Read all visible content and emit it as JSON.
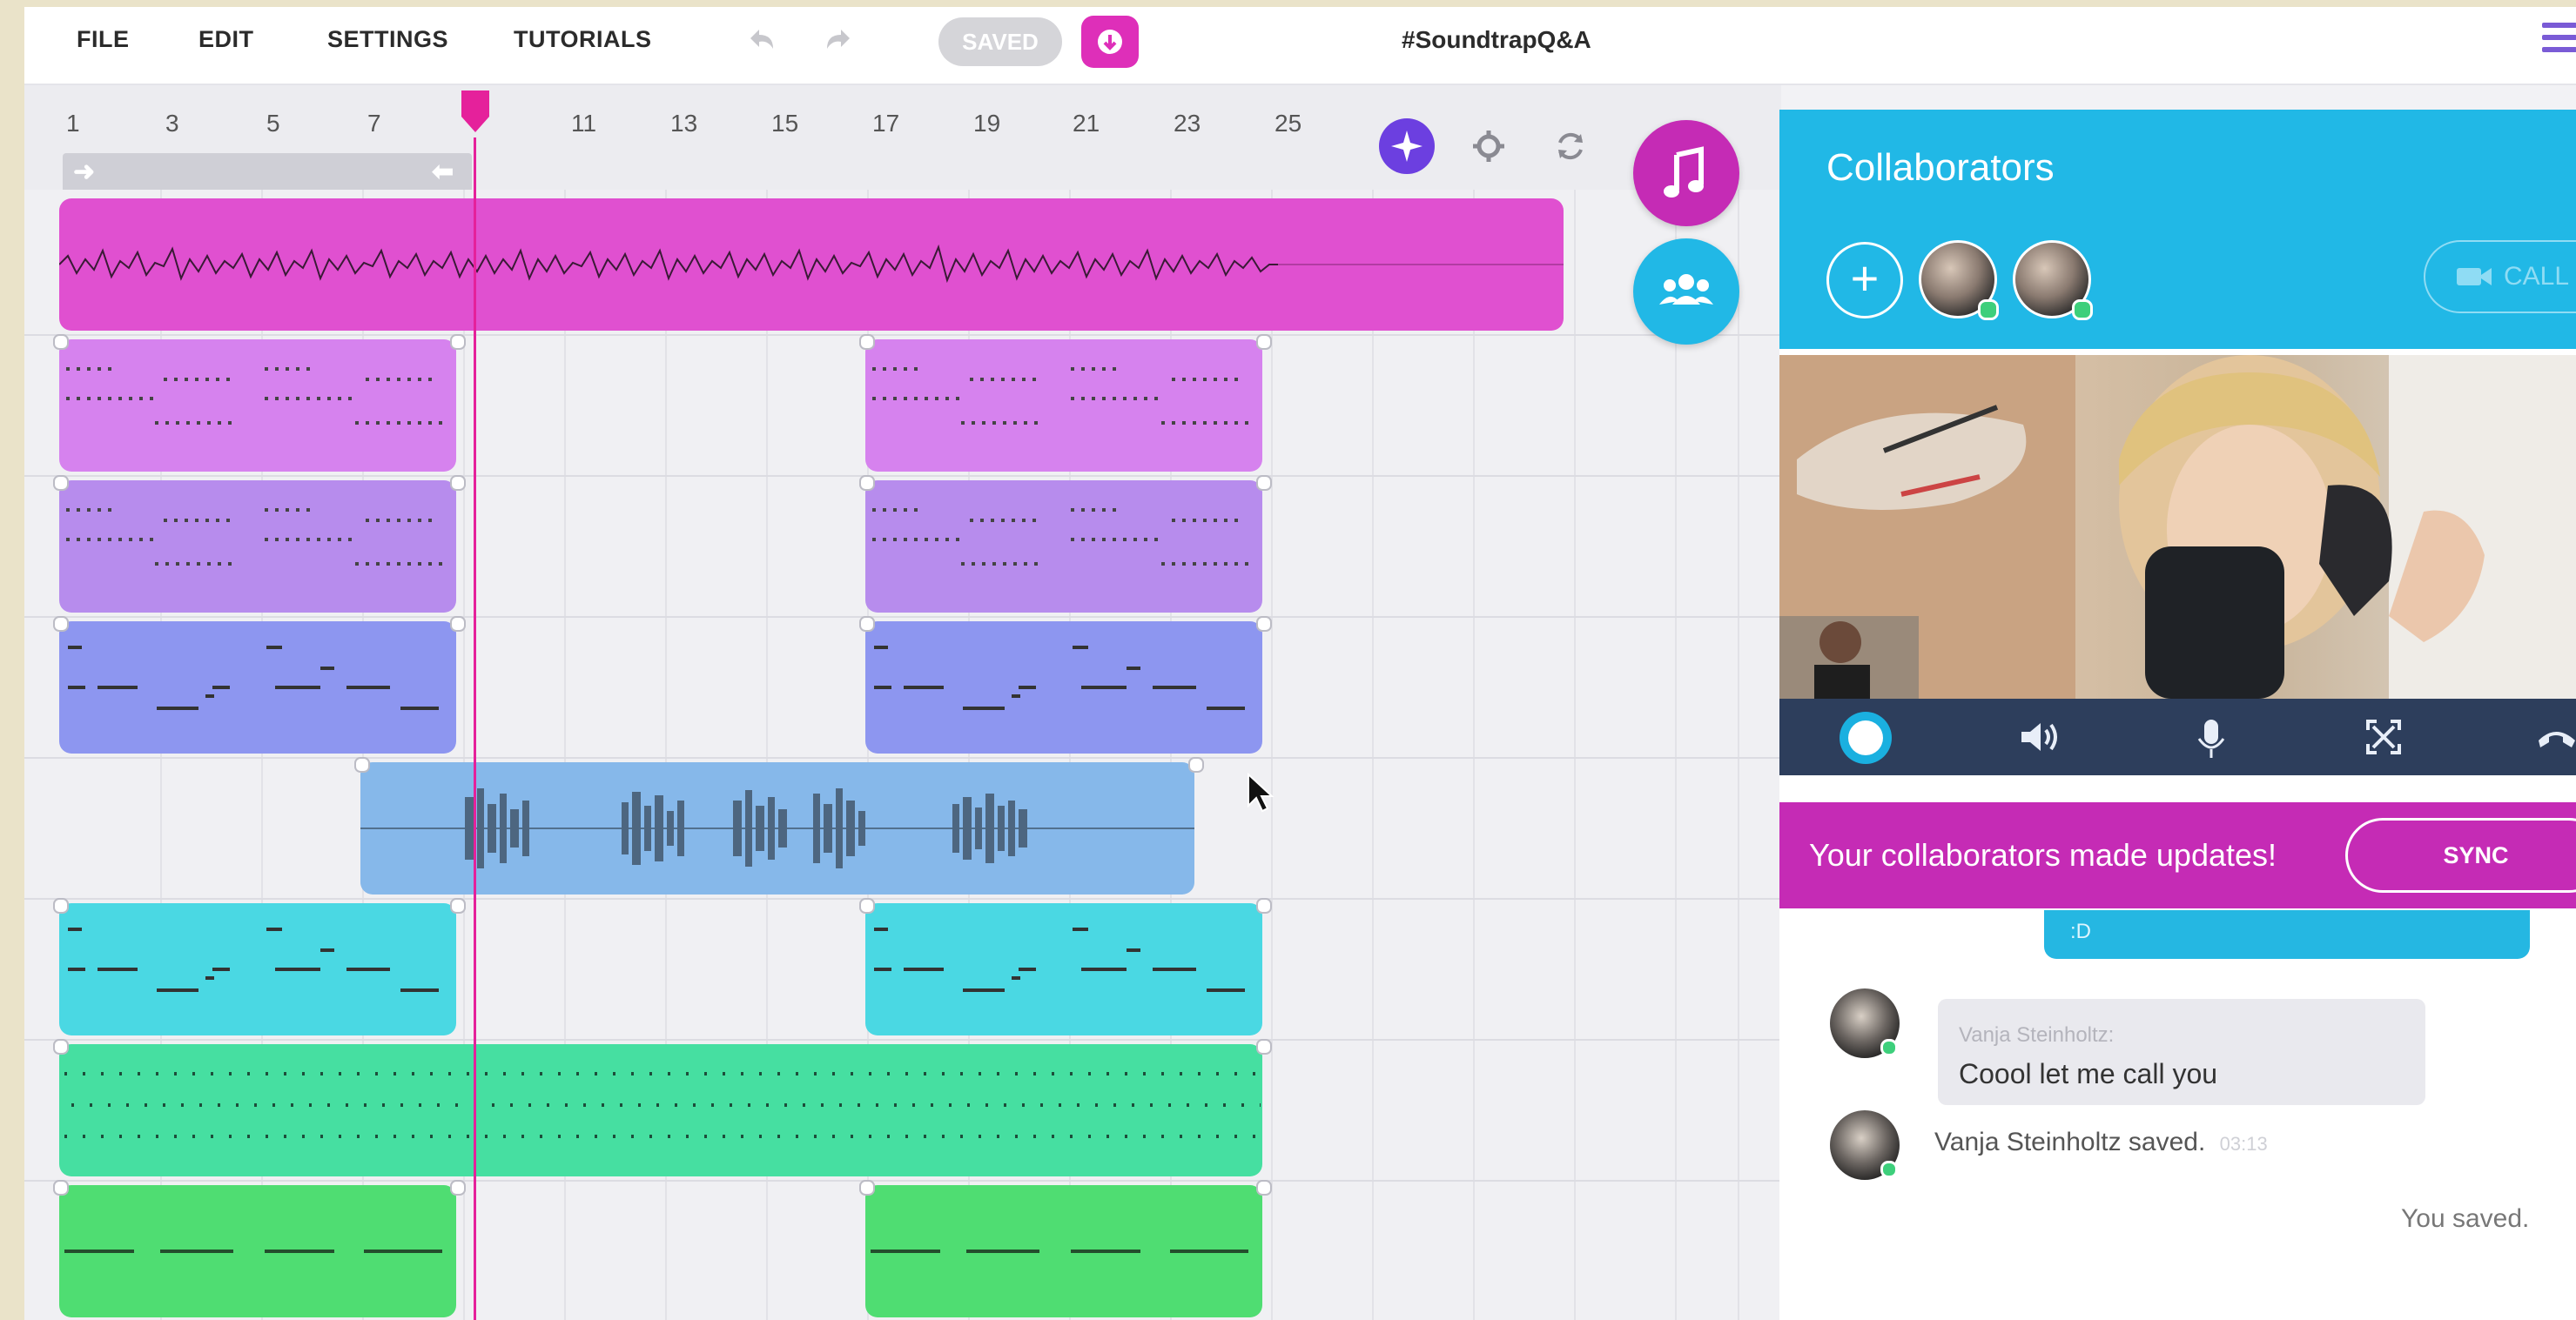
{
  "menu": {
    "file": "FILE",
    "edit": "EDIT",
    "settings": "SETTINGS",
    "tutorials": "TUTORIALS"
  },
  "toolbar": {
    "undo_icon": "undo-arrow",
    "redo_icon": "redo-arrow",
    "saved_label": "SAVED",
    "download_icon": "download-arrow"
  },
  "project_title": "#SoundtrapQ&A",
  "ruler": {
    "ticks": [
      "1",
      "3",
      "5",
      "7",
      "11",
      "13",
      "15",
      "17",
      "19",
      "21",
      "23",
      "25"
    ]
  },
  "tools": {
    "snap_icon": "snap-icon",
    "settings_icon": "gear-icon",
    "loop_icon": "refresh-icon"
  },
  "side_buttons": {
    "instruments_icon": "music-note-icon",
    "collaborate_icon": "people-icon"
  },
  "colors": {
    "accent_pink": "#de2fb9",
    "accent_blue": "#21b8e6",
    "track_colors": [
      "#e050d0",
      "#d682ee",
      "#b78ced",
      "#8d96f0",
      "#86b8ea",
      "#4ad8e3",
      "#46dfa1",
      "#4fdd72"
    ]
  },
  "collaborators": {
    "title": "Collaborators",
    "add_label": "+",
    "call_label": "CALL",
    "updates_text": "Your collaborators made updates!",
    "sync_label": "SYNC"
  },
  "chat": {
    "self_bubble_text": ":D",
    "sender_name": "Vanja Steinholtz:",
    "message": "Coool let me call you",
    "saved_note": "Vanja Steinholtz saved.",
    "saved_time": "03:13",
    "you_saved": "You saved."
  }
}
